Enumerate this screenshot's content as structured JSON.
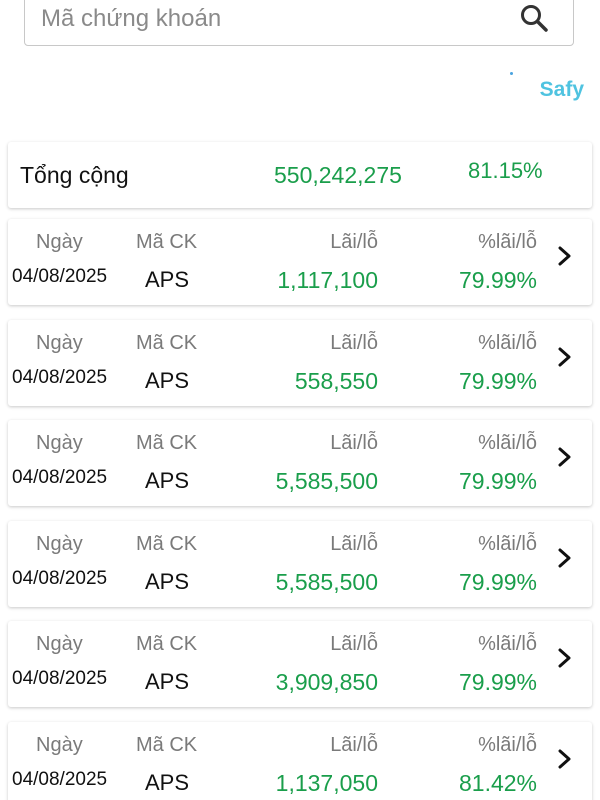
{
  "search": {
    "placeholder": "Mã chứng khoán",
    "value": ""
  },
  "brand": "Safy",
  "total": {
    "label": "Tổng cộng",
    "value": "550,242,275",
    "percent": "81.15%"
  },
  "columns": {
    "date": "Ngày",
    "code": "Mã CK",
    "profit_loss": "Lãi/lỗ",
    "percent": "%lãi/lỗ"
  },
  "rows": [
    {
      "date": "04/08/2025",
      "code": "APS",
      "profit_loss": "1,117,100",
      "percent": "79.99%"
    },
    {
      "date": "04/08/2025",
      "code": "APS",
      "profit_loss": "558,550",
      "percent": "79.99%"
    },
    {
      "date": "04/08/2025",
      "code": "APS",
      "profit_loss": "5,585,500",
      "percent": "79.99%"
    },
    {
      "date": "04/08/2025",
      "code": "APS",
      "profit_loss": "5,585,500",
      "percent": "79.99%"
    },
    {
      "date": "04/08/2025",
      "code": "APS",
      "profit_loss": "3,909,850",
      "percent": "79.99%"
    },
    {
      "date": "04/08/2025",
      "code": "APS",
      "profit_loss": "1,137,050",
      "percent": "81.42%"
    }
  ],
  "colors": {
    "profit": "#1a9e4b",
    "brand": "#4fc3e0",
    "label": "#7a7a7a"
  },
  "icons": {
    "search": "search-icon",
    "row_action": "chevron-right-icon"
  }
}
